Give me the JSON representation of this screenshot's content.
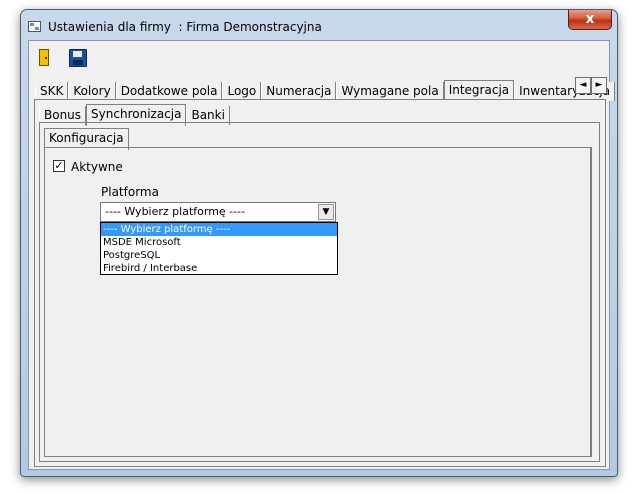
{
  "window": {
    "title": "Ustawienia dla firmy  : Firma Demonstracyjna",
    "close_label": "x"
  },
  "toolbar": {
    "exit_icon": "door-exit-icon",
    "save_icon": "floppy-save-icon"
  },
  "tabs_main": [
    "SKK",
    "Kolory",
    "Dodatkowe pola",
    "Logo",
    "Numeracja",
    "Wymagane pola",
    "Integracja",
    "Inwentaryzacja"
  ],
  "tabs_main_active": "Integracja",
  "tab_scroll": {
    "left": "◄",
    "right": "►"
  },
  "tabs_integration": [
    "Bonus",
    "Synchronizacja",
    "Banki"
  ],
  "tabs_integration_active": "Synchronizacja",
  "tabs_sync": [
    "Konfiguracja"
  ],
  "config": {
    "active_label": "Aktywne",
    "active_checked": true,
    "check_mark": "✓",
    "platform_label": "Platforma",
    "platform_selected": "---- Wybierz platformę ----",
    "dropdown_arrow": "▼",
    "platform_options": [
      "---- Wybierz platformę ----",
      "MSDE Microsoft",
      "PostgreSQL",
      "Firebird / Interbase"
    ],
    "highlighted_index": 0
  }
}
